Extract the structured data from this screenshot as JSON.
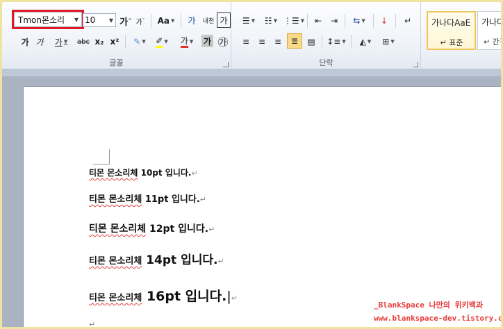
{
  "ribbon": {
    "font_group": {
      "font_name": "Tmon몬소리",
      "font_size": "10",
      "grow_font": "가",
      "shrink_font": "가",
      "change_case": "Aa",
      "phonetic": "가",
      "enclose": "가",
      "bold": "가",
      "italic": "가",
      "underline": "가",
      "strikethrough": "abc",
      "subscript": "x₂",
      "superscript": "x²",
      "font_color_char": "가",
      "char_shading": "가",
      "enclosed_char": "㉮",
      "label": "글꼴"
    },
    "paragraph_group": {
      "label": "단락"
    },
    "styles_group": {
      "style1_preview": "가나다AaE",
      "style1_name": "↵ 표준",
      "style2_preview": "가나다",
      "style2_name": "↵ 간격"
    }
  },
  "document": {
    "lines": [
      {
        "name": "티몬 몬소리체",
        "text": " 10pt 입니다.",
        "mark": "↵"
      },
      {
        "name": "티몬 몬소리체",
        "text": " 11pt 입니다.",
        "mark": "↵"
      },
      {
        "name": "티몬 몬소리체",
        "text": " 12pt 입니다.",
        "mark": "↵"
      },
      {
        "name": "티몬 몬소리체",
        "text": " 14pt 입니다.",
        "mark": "↵"
      },
      {
        "name": "티몬 몬소리체",
        "text": " 16pt 입니다.",
        "mark": "↵"
      }
    ],
    "empty_mark": "↵"
  },
  "watermark": {
    "line1": "_BlankSpace 나만의 위키백과",
    "line2": "www.blankspace-dev.tistory.com"
  },
  "colors": {
    "highlight_red": "#e0192a",
    "font_color": "#e03030",
    "highlight_yellow": "#ffff00",
    "selected_button": "#f9d98a"
  }
}
